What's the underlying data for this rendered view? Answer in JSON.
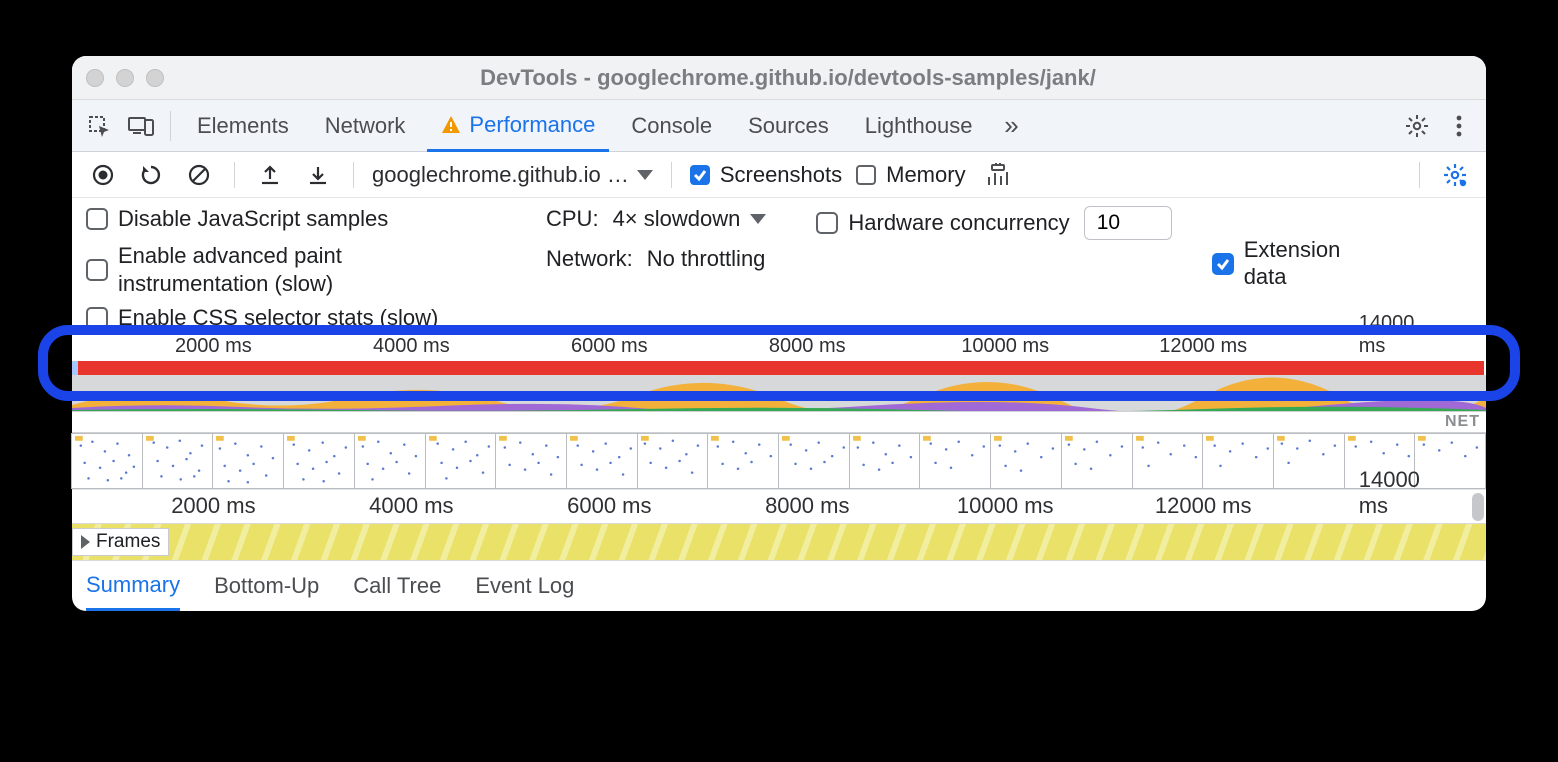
{
  "window": {
    "title": "DevTools - googlechrome.github.io/devtools-samples/jank/"
  },
  "tabs": {
    "items": [
      "Elements",
      "Network",
      "Performance",
      "Console",
      "Sources",
      "Lighthouse"
    ],
    "active": "Performance"
  },
  "toolbar": {
    "target": "googlechrome.github.io …",
    "screenshots_label": "Screenshots",
    "screenshots_checked": true,
    "memory_label": "Memory",
    "memory_checked": false
  },
  "settings": {
    "disable_js_samples": {
      "label": "Disable JavaScript samples",
      "checked": false
    },
    "advanced_paint": {
      "label": "Enable advanced paint instrumentation (slow)",
      "checked": false
    },
    "css_selector_stats": {
      "label": "Enable CSS selector stats (slow)",
      "checked": false
    },
    "cpu_label": "CPU:",
    "cpu_value": "4× slowdown",
    "network_label": "Network:",
    "network_value": "No throttling",
    "hw_concurrency_label": "Hardware concurrency",
    "hw_concurrency_checked": false,
    "hw_concurrency_value": "10",
    "extension_data_label": "Extension data",
    "extension_data_checked": true
  },
  "overview": {
    "ticks": [
      "2000 ms",
      "4000 ms",
      "6000 ms",
      "8000 ms",
      "10000 ms",
      "12000 ms",
      "14000 ms"
    ],
    "net_label": "NET"
  },
  "flamechart": {
    "ticks": [
      "2000 ms",
      "4000 ms",
      "6000 ms",
      "8000 ms",
      "10000 ms",
      "12000 ms",
      "14000 ms"
    ],
    "frames_label": "Frames"
  },
  "bottom_tabs": {
    "items": [
      "Summary",
      "Bottom-Up",
      "Call Tree",
      "Event Log"
    ],
    "active": "Summary"
  }
}
